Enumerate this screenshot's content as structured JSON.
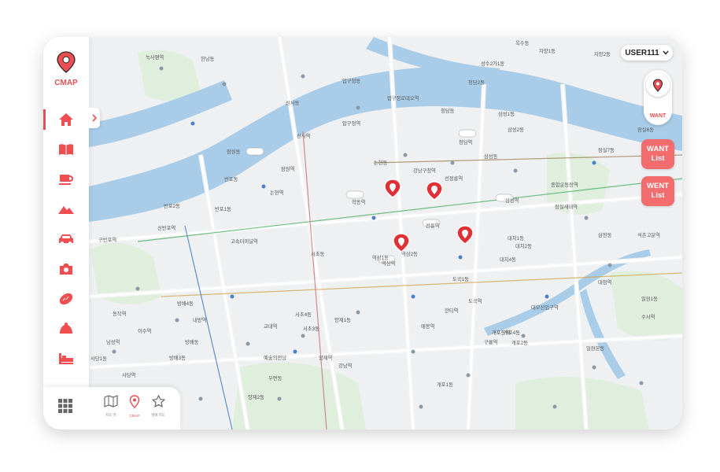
{
  "app": {
    "logo_text": "CMAP",
    "brand_color": "#e94f52"
  },
  "sidebar": {
    "items": [
      {
        "icon": "home-icon",
        "active": true
      },
      {
        "icon": "book-icon",
        "active": false
      },
      {
        "icon": "cafe-cup-icon",
        "active": false
      },
      {
        "icon": "mountain-icon",
        "active": false
      },
      {
        "icon": "car-icon",
        "active": false
      },
      {
        "icon": "camera-icon",
        "active": false
      },
      {
        "icon": "bread-icon",
        "active": false
      },
      {
        "icon": "dessert-icon",
        "active": false
      },
      {
        "icon": "bed-icon",
        "active": false
      }
    ]
  },
  "bottom_bar": {
    "items": [
      {
        "icon": "grid-icon",
        "label": ""
      },
      {
        "icon": "map-icon",
        "label": "지도 뷰"
      },
      {
        "icon": "pin-icon",
        "label": "CMAP"
      },
      {
        "icon": "star-icon",
        "label": "명예 지도"
      }
    ]
  },
  "header": {
    "user_label": "USER111"
  },
  "want_toggle": {
    "label": "WANT"
  },
  "list_buttons": {
    "want": "WANT List",
    "went": "WENT List"
  },
  "map": {
    "labels": [
      "녹사평역",
      "신사동",
      "압구정동",
      "압구정로데오역",
      "청담동",
      "청담역",
      "논현동",
      "반포동",
      "잠원동",
      "논현역",
      "학동역",
      "강남구청역",
      "삼성동",
      "삼성역",
      "반포1동",
      "반포2동",
      "서초동",
      "역삼1동",
      "역삼2동",
      "역삼역",
      "선릉역",
      "선정릉역",
      "대치2동",
      "대치1동",
      "대치4동",
      "도곡1동",
      "도곡역",
      "한티역",
      "매봉역",
      "양재1동",
      "양재역",
      "서초3동",
      "서초4동",
      "방배4동",
      "방배동",
      "내방역",
      "사당역",
      "사당1동",
      "방배3동",
      "고속터미널역",
      "신반포역",
      "구반포역",
      "동작역",
      "이수역",
      "남성역",
      "잠실6동",
      "잠실7동",
      "종합운동장역",
      "잠실새내역",
      "삼전동",
      "석촌고분역",
      "대청역",
      "일원1동",
      "수서역",
      "개포1동",
      "개포2동",
      "개포4동",
      "구룡역",
      "개포동역",
      "대모산입구역",
      "한남동",
      "옥수동",
      "압구정역",
      "신사역",
      "잠원역",
      "교대역",
      "강남역",
      "예술의전당",
      "우면동",
      "양재2동",
      "일원본동",
      "자양1동",
      "자양2동",
      "성수2가1동",
      "청담2동",
      "삼성2동",
      "삼성1동"
    ]
  }
}
